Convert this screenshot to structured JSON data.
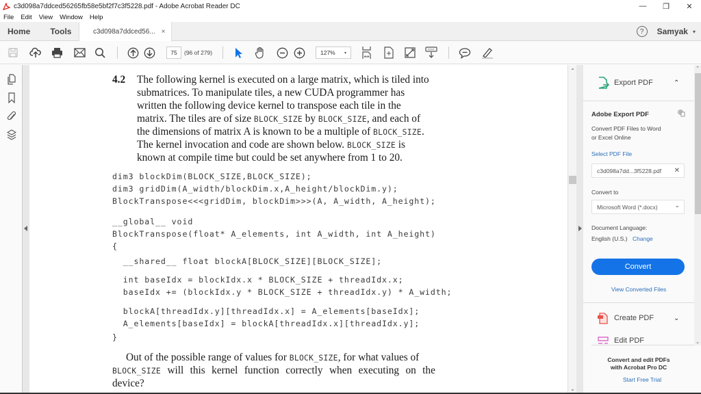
{
  "window": {
    "title": "c3d098a7ddced56265fb58e5bf2f7c3f5228.pdf - Adobe Acrobat Reader DC",
    "controls": {
      "minimize": "—",
      "restore": "❐",
      "close": "✕"
    }
  },
  "menu": [
    "File",
    "Edit",
    "View",
    "Window",
    "Help"
  ],
  "tabs": {
    "home": "Home",
    "tools": "Tools",
    "document": "c3d098a7ddced56...",
    "document_close": "×",
    "help": "?",
    "user": "Samyak",
    "user_caret": "▾"
  },
  "toolbar": {
    "icons": [
      "save-icon",
      "upload-cloud-icon",
      "print-icon",
      "email-icon",
      "search-icon",
      "page-up-icon",
      "page-down-icon",
      "select-arrow-icon",
      "hand-icon",
      "zoom-out-icon",
      "zoom-in-icon",
      "fit-page-icon",
      "rotate-icon",
      "full-screen-icon",
      "read-mode-icon",
      "comment-icon",
      "highlight-pen-icon"
    ],
    "page_current": "75",
    "page_count": "(96 of 279)",
    "zoom_level": "127%",
    "zoom_caret": "▾"
  },
  "left_rail": {
    "icons": [
      "page-thumbnails-icon",
      "bookmark-icon",
      "attachment-icon",
      "layers-icon"
    ]
  },
  "document": {
    "problem_number": "4.2",
    "intro_lines": [
      [
        "The following kernel is executed on a large matrix, which is tiled into"
      ],
      [
        "submatrices. To manipulate tiles, a new CUDA programmer has"
      ],
      [
        "written the following device kernel to transpose each tile in the"
      ],
      [
        "matrix. The tiles are of size ",
        "BLOCK_SIZE",
        " by ",
        "BLOCK_SIZE",
        ", and each of"
      ],
      [
        "the dimensions of matrix A is known to be a multiple of ",
        "BLOCK_SIZE",
        "."
      ],
      [
        "The kernel invocation and code are shown below. ",
        "BLOCK_SIZE",
        " is"
      ],
      [
        "known at compile time but could be set anywhere from 1 to 20."
      ]
    ],
    "code_lines": [
      "dim3 blockDim(BLOCK_SIZE,BLOCK_SIZE);",
      "dim3 gridDim(A_width/blockDim.x,A_height/blockDim.y);",
      "BlockTranspose<<<gridDim, blockDim>>>(A, A_width, A_height);",
      "__global__ void",
      "BlockTranspose(float* A_elements, int A_width, int A_height)",
      "{",
      "  __shared__ float blockA[BLOCK_SIZE][BLOCK_SIZE];",
      "  int baseIdx = blockIdx.x * BLOCK_SIZE + threadIdx.x;",
      "  baseIdx += (blockIdx.y * BLOCK_SIZE + threadIdx.y) * A_width;",
      "  blockA[threadIdx.y][threadIdx.x] = A_elements[baseIdx];",
      "  A_elements[baseIdx] = blockA[threadIdx.x][threadIdx.y];",
      "}"
    ],
    "question_lines": [
      [
        "Out of the possible range of values for ",
        "BLOCK_SIZE",
        ", for what values of"
      ],
      [
        "BLOCK_SIZE",
        " will this kernel function correctly when executing on the"
      ],
      [
        "device?"
      ]
    ]
  },
  "right_panel": {
    "export_pdf": {
      "label": "Export PDF",
      "chevron": "⌃",
      "heading": "Adobe Export PDF",
      "description_line1": "Convert PDF Files to Word",
      "description_line2": "or Excel Online",
      "select_label": "Select PDF File",
      "selected_file": "c3d098a7dd...3f5228.pdf",
      "clear_file": "✕",
      "convert_to_label": "Convert to",
      "convert_to_value": "Microsoft Word (*.docx)",
      "convert_to_caret": "⌄",
      "language_label": "Document Language:",
      "language_value": "English (U.S.)",
      "language_change": "Change",
      "convert_button": "Convert",
      "view_converted": "View Converted Files"
    },
    "create_pdf": {
      "label": "Create PDF",
      "chevron": "⌄"
    },
    "edit_pdf": {
      "label": "Edit PDF"
    },
    "promo": {
      "line1": "Convert and edit PDFs",
      "line2": "with Acrobat Pro DC",
      "link": "Start Free Trial"
    }
  },
  "colors": {
    "accent_blue": "#1473e6",
    "link_blue": "#2a6ebb",
    "export_green": "#2da57a",
    "create_red": "#e8534a",
    "edit_pink": "#d957c6"
  }
}
